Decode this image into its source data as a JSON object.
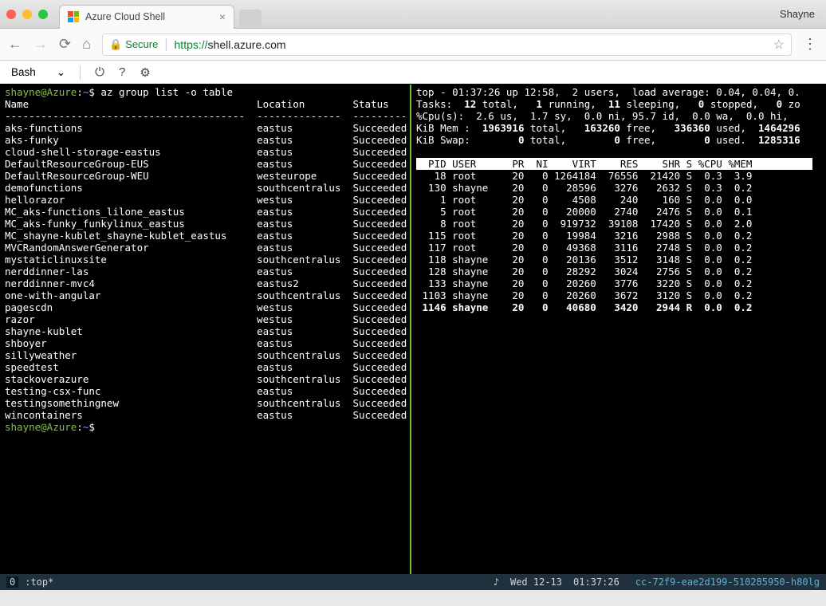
{
  "browser": {
    "user": "Shayne",
    "tab_title": "Azure Cloud Shell",
    "secure_label": "Secure",
    "url_proto": "https://",
    "url_host": "shell.azure.com"
  },
  "shell_toolbar": {
    "selector": "Bash",
    "chevron": "⌄",
    "power": "⏻",
    "help": "?",
    "settings": "⚙"
  },
  "left_pane": {
    "prompt1_host": "shayne@Azure",
    "prompt1_sep": ":",
    "prompt1_path": "~",
    "prompt1_cmd": "$ az group list -o table",
    "columns": "Name                                      Location        Status",
    "dashes": "----------------------------------------  --------------  ---------",
    "rows": [
      [
        "aks-functions",
        "eastus",
        "Succeeded"
      ],
      [
        "aks-funky",
        "eastus",
        "Succeeded"
      ],
      [
        "cloud-shell-storage-eastus",
        "eastus",
        "Succeeded"
      ],
      [
        "DefaultResourceGroup-EUS",
        "eastus",
        "Succeeded"
      ],
      [
        "DefaultResourceGroup-WEU",
        "westeurope",
        "Succeeded"
      ],
      [
        "demofunctions",
        "southcentralus",
        "Succeeded"
      ],
      [
        "hellorazor",
        "westus",
        "Succeeded"
      ],
      [
        "MC_aks-functions_lilone_eastus",
        "eastus",
        "Succeeded"
      ],
      [
        "MC_aks-funky_funkylinux_eastus",
        "eastus",
        "Succeeded"
      ],
      [
        "MC_shayne-kublet_shayne-kublet_eastus",
        "eastus",
        "Succeeded"
      ],
      [
        "MVCRandomAnswerGenerator",
        "eastus",
        "Succeeded"
      ],
      [
        "mystaticlinuxsite",
        "southcentralus",
        "Succeeded"
      ],
      [
        "nerddinner-las",
        "eastus",
        "Succeeded"
      ],
      [
        "nerddinner-mvc4",
        "eastus2",
        "Succeeded"
      ],
      [
        "one-with-angular",
        "southcentralus",
        "Succeeded"
      ],
      [
        "pagescdn",
        "westus",
        "Succeeded"
      ],
      [
        "razor",
        "westus",
        "Succeeded"
      ],
      [
        "shayne-kublet",
        "eastus",
        "Succeeded"
      ],
      [
        "shboyer",
        "eastus",
        "Succeeded"
      ],
      [
        "sillyweather",
        "southcentralus",
        "Succeeded"
      ],
      [
        "speedtest",
        "eastus",
        "Succeeded"
      ],
      [
        "stackoverazure",
        "southcentralus",
        "Succeeded"
      ],
      [
        "testing-csx-func",
        "eastus",
        "Succeeded"
      ],
      [
        "testingsomethingnew",
        "southcentralus",
        "Succeeded"
      ],
      [
        "wincontainers",
        "eastus",
        "Succeeded"
      ]
    ],
    "prompt2_host": "shayne@Azure",
    "prompt2_sep": ":",
    "prompt2_path": "~",
    "prompt2_cmd": "$"
  },
  "right_pane": {
    "summary": [
      "top - 01:37:26 up 12:58,  2 users,  load average: 0.04, 0.04, 0.",
      "Tasks:  12 total,   1 running,  11 sleeping,   0 stopped,   0 zo",
      "%Cpu(s):  2.6 us,  1.7 sy,  0.0 ni, 95.7 id,  0.0 wa,  0.0 hi,",
      "KiB Mem :  1963916 total,   163260 free,   336360 used,  1464296",
      "KiB Swap:        0 total,        0 free,        0 used.  1285316"
    ],
    "header": "  PID USER      PR  NI    VIRT    RES    SHR S %CPU %MEM",
    "procs": [
      [
        "18",
        "root",
        "20",
        "0",
        "1264184",
        "76556",
        "21420",
        "S",
        "0.3",
        "3.9"
      ],
      [
        "130",
        "shayne",
        "20",
        "0",
        "28596",
        "3276",
        "2632",
        "S",
        "0.3",
        "0.2"
      ],
      [
        "1",
        "root",
        "20",
        "0",
        "4508",
        "240",
        "160",
        "S",
        "0.0",
        "0.0"
      ],
      [
        "5",
        "root",
        "20",
        "0",
        "20000",
        "2740",
        "2476",
        "S",
        "0.0",
        "0.1"
      ],
      [
        "8",
        "root",
        "20",
        "0",
        "919732",
        "39108",
        "17420",
        "S",
        "0.0",
        "2.0"
      ],
      [
        "115",
        "root",
        "20",
        "0",
        "19984",
        "3216",
        "2988",
        "S",
        "0.0",
        "0.2"
      ],
      [
        "117",
        "root",
        "20",
        "0",
        "49368",
        "3116",
        "2748",
        "S",
        "0.0",
        "0.2"
      ],
      [
        "118",
        "shayne",
        "20",
        "0",
        "20136",
        "3512",
        "3148",
        "S",
        "0.0",
        "0.2"
      ],
      [
        "128",
        "shayne",
        "20",
        "0",
        "28292",
        "3024",
        "2756",
        "S",
        "0.0",
        "0.2"
      ],
      [
        "133",
        "shayne",
        "20",
        "0",
        "20260",
        "3776",
        "3220",
        "S",
        "0.0",
        "0.2"
      ],
      [
        "1103",
        "shayne",
        "20",
        "0",
        "20260",
        "3672",
        "3120",
        "S",
        "0.0",
        "0.2"
      ],
      [
        "1146",
        "shayne",
        "20",
        "0",
        "40680",
        "3420",
        "2944",
        "R",
        "0.0",
        "0.2"
      ]
    ]
  },
  "status": {
    "zero": "0",
    "label": ":top*",
    "note": "♪",
    "date": "Wed 12-13",
    "time": "01:37:26",
    "session": "cc-72f9-eae2d199-510285950-h80lg"
  }
}
